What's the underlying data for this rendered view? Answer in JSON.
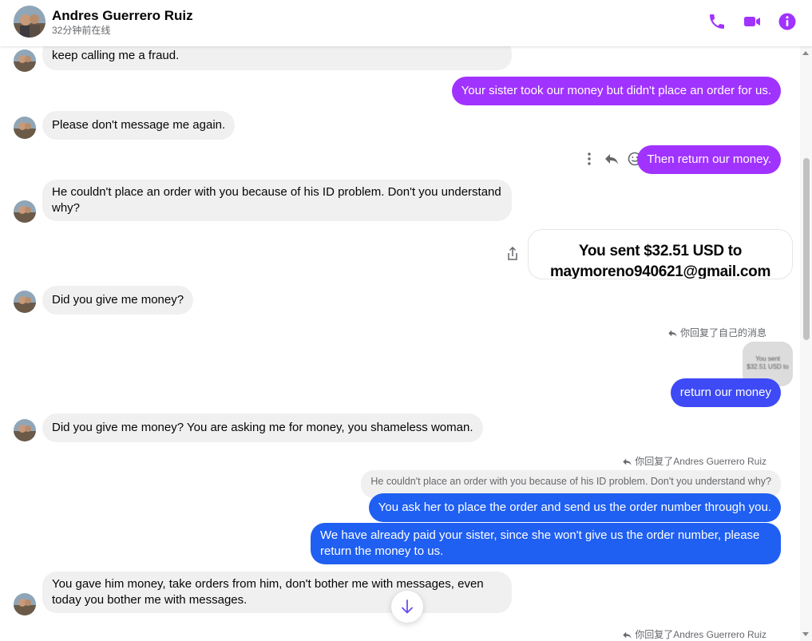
{
  "header": {
    "name": "Andres Guerrero Ruiz",
    "status": "32分钟前在线",
    "icons": [
      "phone-icon",
      "video-call-icon",
      "info-icon"
    ],
    "accent": "#a033ff"
  },
  "messages": {
    "m1": "keep calling me a fraud.",
    "m2": "Your sister took our money but didn't place an order for us.",
    "m3": "Please don't message me again.",
    "m4": "Then return our money.",
    "m5": "He couldn't place an order with you because of his ID problem. Don't you understand why?",
    "m6_card": "You sent $32.51 USD to maymoreno940621@gmail.com",
    "m7": "Did you give me money?",
    "m8_reply_note": "你回复了自己的消息",
    "m8_thumb_text": "You sent $32.51 USD to",
    "m8": "return our money",
    "m9": "Did you give me money? You are asking me for money, you shameless woman.",
    "m10_reply_note": "你回复了Andres Guerrero Ruiz",
    "m10_quoted": "He couldn't place an order with you because of his ID problem. Don't you understand why?",
    "m10": "You ask her to place the order and send us the order number through you.",
    "m11": "We have already paid your sister, since she won't give us the order number, please return the money to us.",
    "m12": "You gave him money, take orders from him, don't bother me with messages, even today you bother me with messages.",
    "m13_reply_note": "你回复了Andres Guerrero Ruiz"
  },
  "colors": {
    "incoming": "#f0f0f0",
    "outgoing_purple": "#a033ff",
    "outgoing_blue": "#1f5ff1"
  }
}
